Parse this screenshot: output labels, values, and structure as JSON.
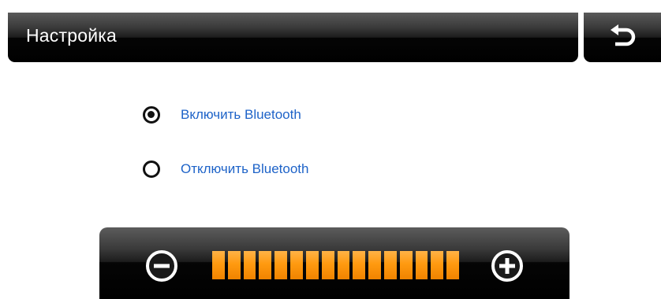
{
  "header": {
    "title": "Настройка",
    "back_icon": "back-arrow-icon"
  },
  "bluetooth": {
    "options": [
      {
        "label": "Включить Bluetooth",
        "selected": true
      },
      {
        "label": "Отключить Bluetooth",
        "selected": false
      }
    ]
  },
  "volume": {
    "minus_icon": "minus-circle-icon",
    "plus_icon": "plus-circle-icon",
    "level_segments": 16,
    "level_filled": 16,
    "level_fraction": 1.0,
    "fill_color": "#ff9a10"
  },
  "colors": {
    "accent_text": "#1e63c8",
    "bar_dark": "#000000"
  }
}
